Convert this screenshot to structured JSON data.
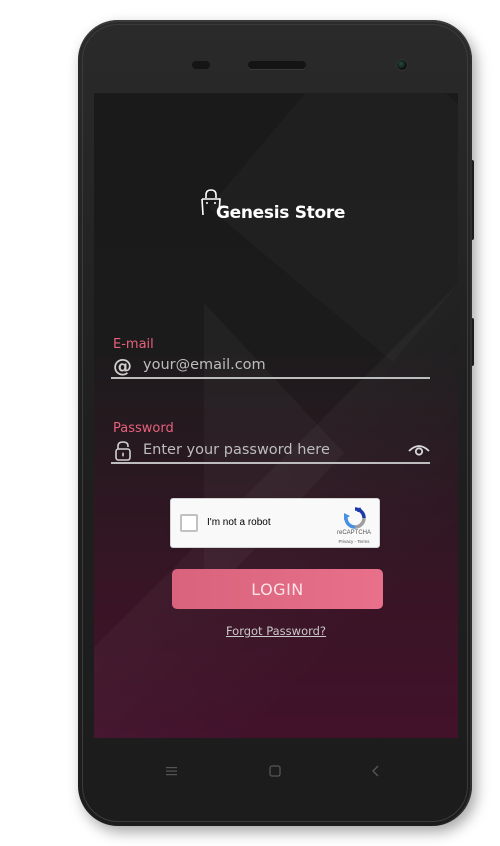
{
  "app": {
    "name": "Genesis Store"
  },
  "form": {
    "email": {
      "label": "E-mail",
      "placeholder": "your@email.com",
      "value": ""
    },
    "password": {
      "label": "Password",
      "placeholder": "Enter your password here",
      "value": ""
    },
    "recaptcha": {
      "checkbox_label": "I'm not a robot",
      "brand": "reCAPTCHA",
      "links": "Privacy - Terms",
      "checked": false
    },
    "login_label": "LOGIN",
    "forgot_label": "Forgot Password?"
  },
  "device": {
    "nav_keys": [
      "menu-key",
      "home-key",
      "back-key"
    ]
  },
  "colors": {
    "accent": "#e8607c",
    "button": "#e06d86",
    "background_top": "#1a1a1a",
    "background_bottom": "#42122b"
  }
}
